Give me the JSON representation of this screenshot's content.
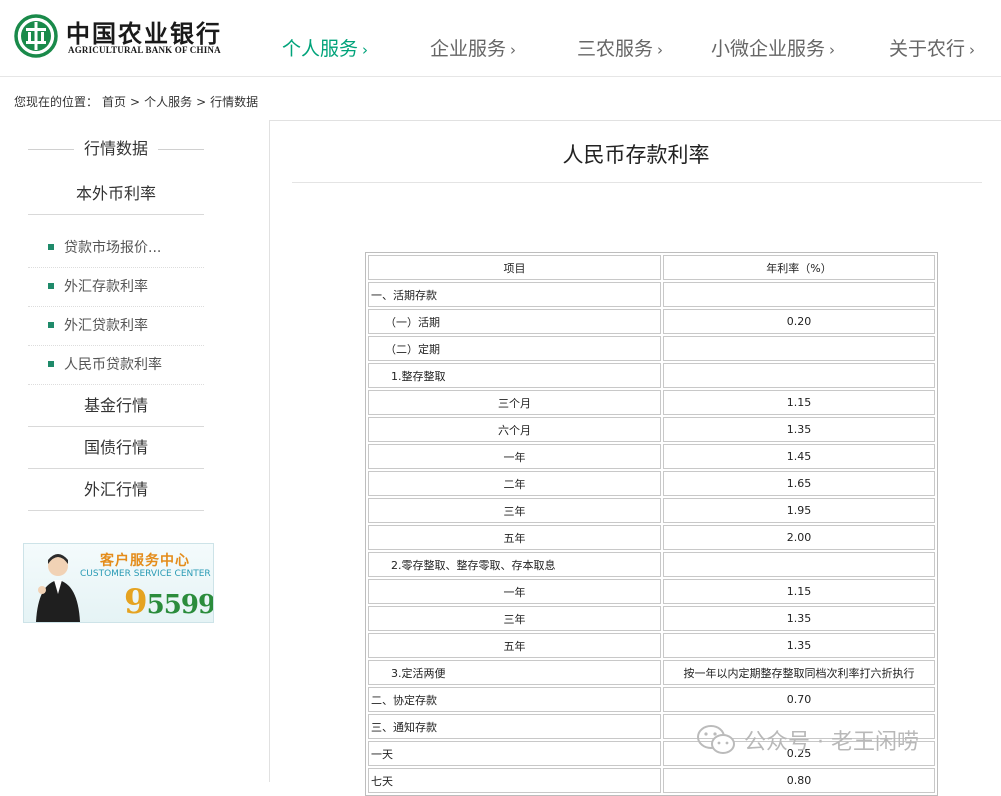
{
  "header": {
    "logo_cn": "中国农业银行",
    "logo_en": "AGRICULTURAL BANK OF CHINA",
    "nav": [
      {
        "label": "个人服务",
        "active": true
      },
      {
        "label": "企业服务",
        "active": false
      },
      {
        "label": "三农服务",
        "active": false
      },
      {
        "label": "小微企业服务",
        "active": false
      },
      {
        "label": "关于农行",
        "active": false
      }
    ],
    "chevron": "›",
    "accent_color": "#00a37a"
  },
  "breadcrumb": {
    "prefix": "您现在的位置：",
    "items": [
      "首页",
      "个人服务",
      "行情数据"
    ],
    "separator": ">"
  },
  "sidebar": {
    "title": "行情数据",
    "main_item": "本外币利率",
    "sub_items": [
      "贷款市场报价...",
      "外汇存款利率",
      "外汇贷款利率",
      "人民币贷款利率"
    ],
    "categories": [
      "基金行情",
      "国债行情",
      "外汇行情"
    ]
  },
  "banner": {
    "title_cn": "客户服务中心",
    "title_en": "CUSTOMER SERVICE CENTER",
    "number_first": "9",
    "number_rest": "5599"
  },
  "main": {
    "title": "人民币存款利率",
    "table": {
      "headers": [
        "项目",
        "年利率（%）"
      ],
      "rows": [
        {
          "item": "一、活期存款",
          "rate": "",
          "indent": 0
        },
        {
          "item": "（一）活期",
          "rate": "0.20",
          "indent": 1
        },
        {
          "item": "（二）定期",
          "rate": "",
          "indent": 1
        },
        {
          "item": "1.整存整取",
          "rate": "",
          "indent": 2
        },
        {
          "item": "三个月",
          "rate": "1.15",
          "indent": 3
        },
        {
          "item": "六个月",
          "rate": "1.35",
          "indent": 3
        },
        {
          "item": "一年",
          "rate": "1.45",
          "indent": 3
        },
        {
          "item": "二年",
          "rate": "1.65",
          "indent": 3
        },
        {
          "item": "三年",
          "rate": "1.95",
          "indent": 3
        },
        {
          "item": "五年",
          "rate": "2.00",
          "indent": 3
        },
        {
          "item": "2.零存整取、整存零取、存本取息",
          "rate": "",
          "indent": 2
        },
        {
          "item": "一年",
          "rate": "1.15",
          "indent": 3
        },
        {
          "item": "三年",
          "rate": "1.35",
          "indent": 3
        },
        {
          "item": "五年",
          "rate": "1.35",
          "indent": 3
        },
        {
          "item": "3.定活两便",
          "rate": "按一年以内定期整存整取同档次利率打六折执行",
          "indent": 2
        },
        {
          "item": "二、协定存款",
          "rate": "0.70",
          "indent": 0
        },
        {
          "item": "三、通知存款",
          "rate": "",
          "indent": 0
        },
        {
          "item": "一天",
          "rate": "0.25",
          "indent": 0
        },
        {
          "item": "七天",
          "rate": "0.80",
          "indent": 0
        }
      ]
    }
  },
  "watermark": {
    "text": "公众号 · 老王闲唠"
  }
}
